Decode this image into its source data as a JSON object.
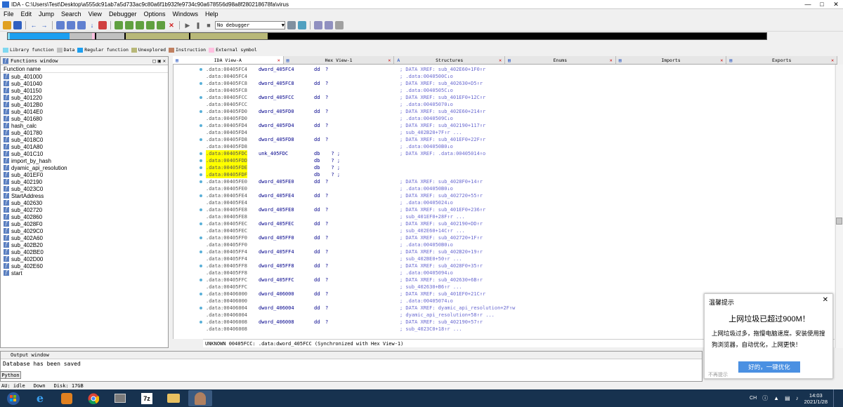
{
  "window": {
    "title": "IDA - C:\\Users\\Test\\Desktop\\a555dc91ab7a5d733ac9c80a6f1b932fe9734c90a678556d98a8f280218678fa\\virus"
  },
  "menu": [
    "File",
    "Edit",
    "Jump",
    "Search",
    "View",
    "Debugger",
    "Options",
    "Windows",
    "Help"
  ],
  "toolbar": {
    "debugger_select": "No debugger"
  },
  "legend": [
    {
      "label": "Library function",
      "color": "#80d8f0"
    },
    {
      "label": "Data",
      "color": "#c0c0c0"
    },
    {
      "label": "Regular function",
      "color": "#1c9ff0"
    },
    {
      "label": "Unexplored",
      "color": "#b8b878"
    },
    {
      "label": "Instruction",
      "color": "#c08060"
    },
    {
      "label": "External symbol",
      "color": "#ffc0e0"
    }
  ],
  "functions_window": {
    "title": "Functions window",
    "column": "Function name",
    "items": [
      "sub_401000",
      "sub_401040",
      "sub_401150",
      "sub_401220",
      "sub_4012B0",
      "sub_4014E0",
      "sub_401680",
      "hash_calc",
      "sub_401780",
      "sub_4018C0",
      "sub_401A80",
      "sub_401C10",
      "import_by_hash",
      "dyamic_api_resolution",
      "sub_401EF0",
      "sub_402190",
      "sub_4023C0",
      "StartAddress",
      "sub_402630",
      "sub_402720",
      "sub_402860",
      "sub_4028F0",
      "sub_4029C0",
      "sub_402A60",
      "sub_402B20",
      "sub_402BE0",
      "sub_402D00",
      "sub_402E60",
      "start"
    ]
  },
  "tabs": [
    {
      "label": "IDA View-A",
      "active": true
    },
    {
      "label": "Hex View-1",
      "active": false
    },
    {
      "label": "Structures",
      "active": false
    },
    {
      "label": "Enums",
      "active": false
    },
    {
      "label": "Imports",
      "active": false
    },
    {
      "label": "Exports",
      "active": false
    }
  ],
  "disasm": [
    {
      "dot": true,
      "addr": ".data:00405FC4",
      "label": "dword_405FC4",
      "mn": "dd",
      "op": "?",
      "cmt": "; DATA XREF: sub_402E60+1F0↑r"
    },
    {
      "dot": false,
      "addr": ".data:00405FC4",
      "label": "",
      "mn": "",
      "op": "",
      "cmt": "; .data:0040500C↓o"
    },
    {
      "dot": true,
      "addr": ".data:00405FC8",
      "label": "dword_405FC8",
      "mn": "dd",
      "op": "?",
      "cmt": "; DATA XREF: sub_402630+D5↑r"
    },
    {
      "dot": false,
      "addr": ".data:00405FC8",
      "label": "",
      "mn": "",
      "op": "",
      "cmt": "; .data:0040505C↓o"
    },
    {
      "dot": true,
      "addr": ".data:00405FCC",
      "label": "dword_405FCC",
      "mn": "dd",
      "op": "?",
      "cmt": "; DATA XREF: sub_401EF0+12C↑r"
    },
    {
      "dot": false,
      "addr": ".data:00405FCC",
      "label": "",
      "mn": "",
      "op": "",
      "cmt": "; .data:00405070↓o"
    },
    {
      "dot": true,
      "addr": ".data:00405FD0",
      "label": "dword_405FD0",
      "mn": "dd",
      "op": "?",
      "cmt": "; DATA XREF: sub_402E60+214↑r"
    },
    {
      "dot": false,
      "addr": ".data:00405FD0",
      "label": "",
      "mn": "",
      "op": "",
      "cmt": "; .data:0040509C↓o"
    },
    {
      "dot": true,
      "addr": ".data:00405FD4",
      "label": "dword_405FD4",
      "mn": "dd",
      "op": "?",
      "cmt": "; DATA XREF: sub_402190+117↑r"
    },
    {
      "dot": false,
      "addr": ".data:00405FD4",
      "label": "",
      "mn": "",
      "op": "",
      "cmt": "; sub_402B20+7F↑r ..."
    },
    {
      "dot": true,
      "addr": ".data:00405FD8",
      "label": "dword_405FD8",
      "mn": "dd",
      "op": "?",
      "cmt": "; DATA XREF: sub_401EF0+22F↑r"
    },
    {
      "dot": false,
      "addr": ".data:00405FD8",
      "label": "",
      "mn": "",
      "op": "",
      "cmt": "; .data:004050B0↓o"
    },
    {
      "dot": true,
      "addr": ".data:00405FDC",
      "label": "unk_405FDC",
      "mn": "db",
      "op": "  ? ;",
      "cmt": "; DATA XREF: .data:00405014↑o",
      "hl": true
    },
    {
      "dot": true,
      "addr": ".data:00405FDD",
      "label": "",
      "mn": "db",
      "op": "  ? ;",
      "cmt": "",
      "hl": true
    },
    {
      "dot": true,
      "addr": ".data:00405FDE",
      "label": "",
      "mn": "db",
      "op": "  ? ;",
      "cmt": "",
      "hl": true
    },
    {
      "dot": true,
      "addr": ".data:00405FDF",
      "label": "",
      "mn": "db",
      "op": "  ? ;",
      "cmt": "",
      "hl": true
    },
    {
      "dot": true,
      "addr": ".data:00405FE0",
      "label": "dword_405FE0",
      "mn": "dd",
      "op": "?",
      "cmt": "; DATA XREF: sub_4028F0+14↑r"
    },
    {
      "dot": false,
      "addr": ".data:00405FE0",
      "label": "",
      "mn": "",
      "op": "",
      "cmt": "; .data:004050B0↓o"
    },
    {
      "dot": true,
      "addr": ".data:00405FE4",
      "label": "dword_405FE4",
      "mn": "dd",
      "op": "?",
      "cmt": "; DATA XREF: sub_402720+55↑r"
    },
    {
      "dot": false,
      "addr": ".data:00405FE4",
      "label": "",
      "mn": "",
      "op": "",
      "cmt": "; .data:00405024↓o"
    },
    {
      "dot": true,
      "addr": ".data:00405FE8",
      "label": "dword_405FE8",
      "mn": "dd",
      "op": "?",
      "cmt": "; DATA XREF: sub_401EF0+236↑r"
    },
    {
      "dot": false,
      "addr": ".data:00405FE8",
      "label": "",
      "mn": "",
      "op": "",
      "cmt": "; sub_401EF0+28F↑r ..."
    },
    {
      "dot": true,
      "addr": ".data:00405FEC",
      "label": "dword_405FEC",
      "mn": "dd",
      "op": "?",
      "cmt": "; DATA XREF: sub_402190+DD↑r"
    },
    {
      "dot": false,
      "addr": ".data:00405FEC",
      "label": "",
      "mn": "",
      "op": "",
      "cmt": "; sub_402E60+14C↑r ..."
    },
    {
      "dot": true,
      "addr": ".data:00405FF0",
      "label": "dword_405FF0",
      "mn": "dd",
      "op": "?",
      "cmt": "; DATA XREF: sub_402720+1F↑r"
    },
    {
      "dot": false,
      "addr": ".data:00405FF0",
      "label": "",
      "mn": "",
      "op": "",
      "cmt": "; .data:004050B0↓o"
    },
    {
      "dot": true,
      "addr": ".data:00405FF4",
      "label": "dword_405FF4",
      "mn": "dd",
      "op": "?",
      "cmt": "; DATA XREF: sub_402B20+19↑r"
    },
    {
      "dot": false,
      "addr": ".data:00405FF4",
      "label": "",
      "mn": "",
      "op": "",
      "cmt": "; sub_402BE0+50↑r ..."
    },
    {
      "dot": true,
      "addr": ".data:00405FF8",
      "label": "dword_405FF8",
      "mn": "dd",
      "op": "?",
      "cmt": "; DATA XREF: sub_4028F0+35↑r"
    },
    {
      "dot": false,
      "addr": ".data:00405FF8",
      "label": "",
      "mn": "",
      "op": "",
      "cmt": "; .data:00405094↓o"
    },
    {
      "dot": true,
      "addr": ".data:00405FFC",
      "label": "dword_405FFC",
      "mn": "dd",
      "op": "?",
      "cmt": "; DATA XREF: sub_402630+6B↑r"
    },
    {
      "dot": false,
      "addr": ".data:00405FFC",
      "label": "",
      "mn": "",
      "op": "",
      "cmt": "; sub_402630+B6↑r ..."
    },
    {
      "dot": true,
      "addr": ".data:00406000",
      "label": "dword_406000",
      "mn": "dd",
      "op": "?",
      "cmt": "; DATA XREF: sub_401EF0+21C↑r"
    },
    {
      "dot": false,
      "addr": ".data:00406000",
      "label": "",
      "mn": "",
      "op": "",
      "cmt": "; .data:00405074↓o"
    },
    {
      "dot": true,
      "addr": ".data:00406004",
      "label": "dword_406004",
      "mn": "dd",
      "op": "?",
      "cmt": "; DATA XREF: dyamic_api_resolution+2F↑w"
    },
    {
      "dot": false,
      "addr": ".data:00406004",
      "label": "",
      "mn": "",
      "op": "",
      "cmt": "; dyamic_api_resolution+58↑r ..."
    },
    {
      "dot": true,
      "addr": ".data:00406008",
      "label": "dword_406008",
      "mn": "dd",
      "op": "?",
      "cmt": "; DATA XREF: sub_402190+57↑r"
    },
    {
      "dot": false,
      "addr": ".data:00406008",
      "label": "",
      "mn": "",
      "op": "",
      "cmt": "; sub_4023C0+18↑r ..."
    }
  ],
  "sync_status": "UNKNOWN 00405FCC: .data:dword_405FCC (Synchronized with Hex View-1)",
  "output_window": {
    "title": "Output window",
    "text": "Database has been saved",
    "python_btn": "Python"
  },
  "status": {
    "au": "AU:  idle",
    "dir": "Down",
    "disk": "Disk: 17GB"
  },
  "popup": {
    "title": "温馨提示",
    "headline": "上网垃圾已超过900M！",
    "desc": "上网垃圾过多，拖慢电脑速度。安装使用搜狗浏览器，自动优化，上网更快！",
    "button": "好的，一键优化",
    "skip": "不再提示"
  },
  "clock": {
    "time": "14:03",
    "date": "2021/1/28"
  },
  "tray_text": "CH"
}
